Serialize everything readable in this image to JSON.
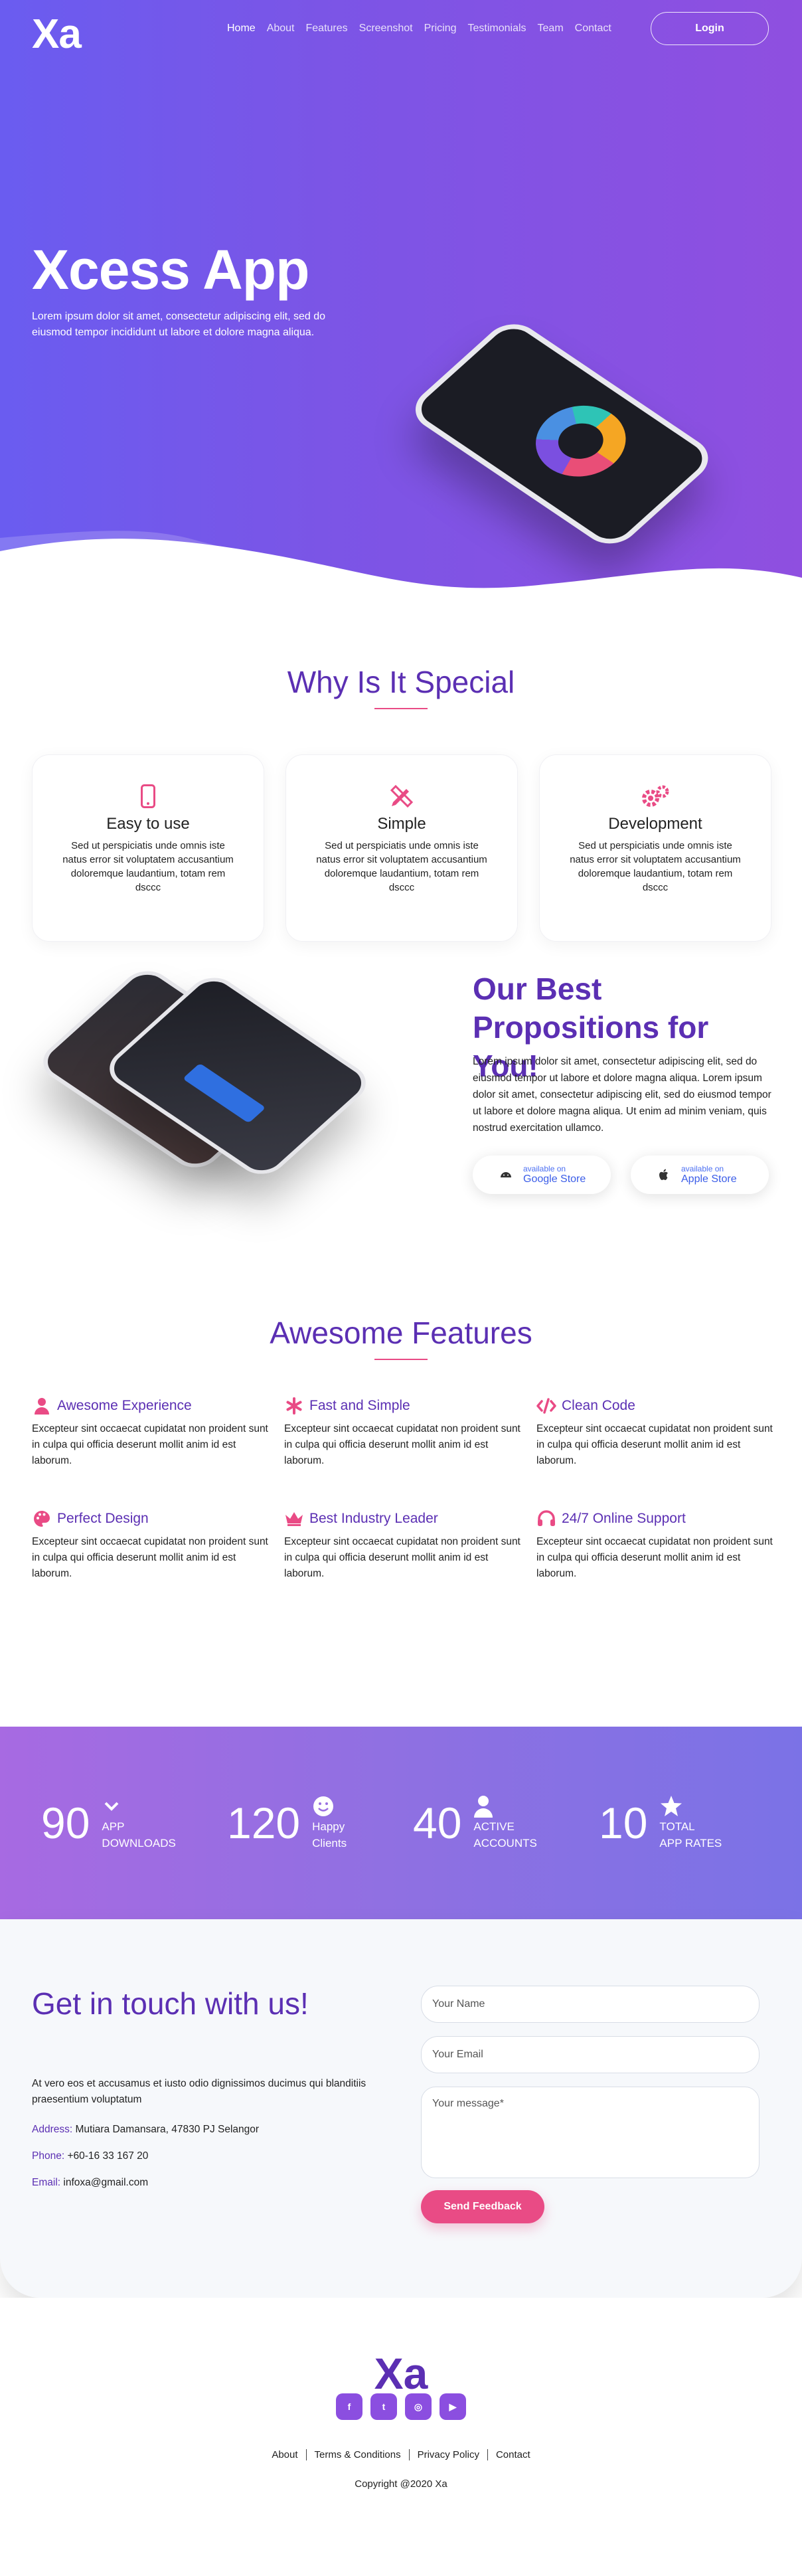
{
  "brand": {
    "logo": "Xa"
  },
  "nav": {
    "items": [
      "Home",
      "About",
      "Features",
      "Screenshot",
      "Pricing",
      "Testimonials",
      "Team",
      "Contact"
    ],
    "active": "Home",
    "login_label": "Login"
  },
  "hero": {
    "title": "Xcess App",
    "text": "Lorem ipsum dolor sit amet, consectetur adipiscing elit, sed do eiusmod tempor incididunt ut labore et dolore magna aliqua."
  },
  "colors": {
    "primary": "#5b2fb3",
    "accent": "#e94b85",
    "hero_start": "#6a5cf0",
    "hero_end": "#8f4fe0"
  },
  "why": {
    "title": "Why Is It Special",
    "cards": [
      {
        "icon": "mobile-icon",
        "title": "Easy to use",
        "text": "Sed ut perspiciatis unde omnis iste natus error sit voluptatem accusantium doloremque laudantium, totam rem dsccc"
      },
      {
        "icon": "pencil-ruler-icon",
        "title": "Simple",
        "text": "Sed ut perspiciatis unde omnis iste natus error sit voluptatem accusantium doloremque laudantium, totam rem dsccc"
      },
      {
        "icon": "gears-icon",
        "title": "Development",
        "text": "Sed ut perspiciatis unde omnis iste natus error sit voluptatem accusantium doloremque laudantium, totam rem dsccc"
      }
    ]
  },
  "propositions": {
    "title": "Our Best Propositions for You!",
    "text": "Lorem ipsum dolor sit amet, consectetur adipiscing elit, sed do eiusmod tempor ut labore et dolore magna aliqua. Lorem ipsum dolor sit amet, consectetur adipiscing elit, sed do eiusmod tempor ut labore et dolore magna aliqua. Ut enim ad minim veniam, quis nostrud exercitation ullamco.",
    "google": {
      "small": "available on",
      "label": "Google Store",
      "icon": "android-icon"
    },
    "apple": {
      "small": "available on",
      "label": "Apple Store",
      "icon": "apple-icon"
    }
  },
  "features": {
    "title": "Awesome Features",
    "items": [
      {
        "icon": "user-icon",
        "title": "Awesome Experience",
        "text": "Excepteur sint occaecat cupidatat non proident sunt in culpa qui officia deserunt mollit anim id est laborum."
      },
      {
        "icon": "asterisk-icon",
        "title": "Fast and Simple",
        "text": "Excepteur sint occaecat cupidatat non proident sunt in culpa qui officia deserunt mollit anim id est laborum."
      },
      {
        "icon": "code-icon",
        "title": "Clean Code",
        "text": "Excepteur sint occaecat cupidatat non proident sunt in culpa qui officia deserunt mollit anim id est laborum."
      },
      {
        "icon": "palette-icon",
        "title": "Perfect Design",
        "text": "Excepteur sint occaecat cupidatat non proident sunt in culpa qui officia deserunt mollit anim id est laborum."
      },
      {
        "icon": "crown-icon",
        "title": "Best Industry Leader",
        "text": "Excepteur sint occaecat cupidatat non proident sunt in culpa qui officia deserunt mollit anim id est laborum."
      },
      {
        "icon": "headset-icon",
        "title": "24/7 Online Support",
        "text": "Excepteur sint occaecat cupidatat non proident sunt in culpa qui officia deserunt mollit anim id est laborum."
      }
    ]
  },
  "stats": [
    {
      "value": "90",
      "line1": "APP",
      "line2": "DOWNLOADS",
      "icon": "chevron-down-icon"
    },
    {
      "value": "120",
      "line1": "Happy",
      "line2": "Clients",
      "icon": "smile-icon"
    },
    {
      "value": "40",
      "line1": "ACTIVE",
      "line2": "ACCOUNTS",
      "icon": "user-icon"
    },
    {
      "value": "10",
      "line1": "TOTAL",
      "line2": "APP RATES",
      "icon": "star-icon"
    }
  ],
  "contact": {
    "title": "Get in touch with us!",
    "text": "At vero eos et accusamus et iusto odio dignissimos ducimus qui blanditiis praesentium voluptatum",
    "address_label": "Address:",
    "address": "Mutiara Damansara, 47830 PJ Selangor",
    "phone_label": "Phone:",
    "phone": "+60-16 33 167 20",
    "email_label": "Email:",
    "email": "infoxa@gmail.com",
    "name_placeholder": "Your Name",
    "email_placeholder": "Your Email",
    "message_placeholder": "Your message*",
    "send_label": "Send Feedback"
  },
  "footer": {
    "logo": "Xa",
    "socials": [
      {
        "icon": "facebook-icon",
        "glyph": "f"
      },
      {
        "icon": "twitter-icon",
        "glyph": "t"
      },
      {
        "icon": "instagram-icon",
        "glyph": "◎"
      },
      {
        "icon": "youtube-icon",
        "glyph": "▶"
      }
    ],
    "links": [
      "About",
      "Terms & Conditions",
      "Privacy Policy",
      "Contact"
    ],
    "copyright": "Copyright @2020 Xa"
  }
}
